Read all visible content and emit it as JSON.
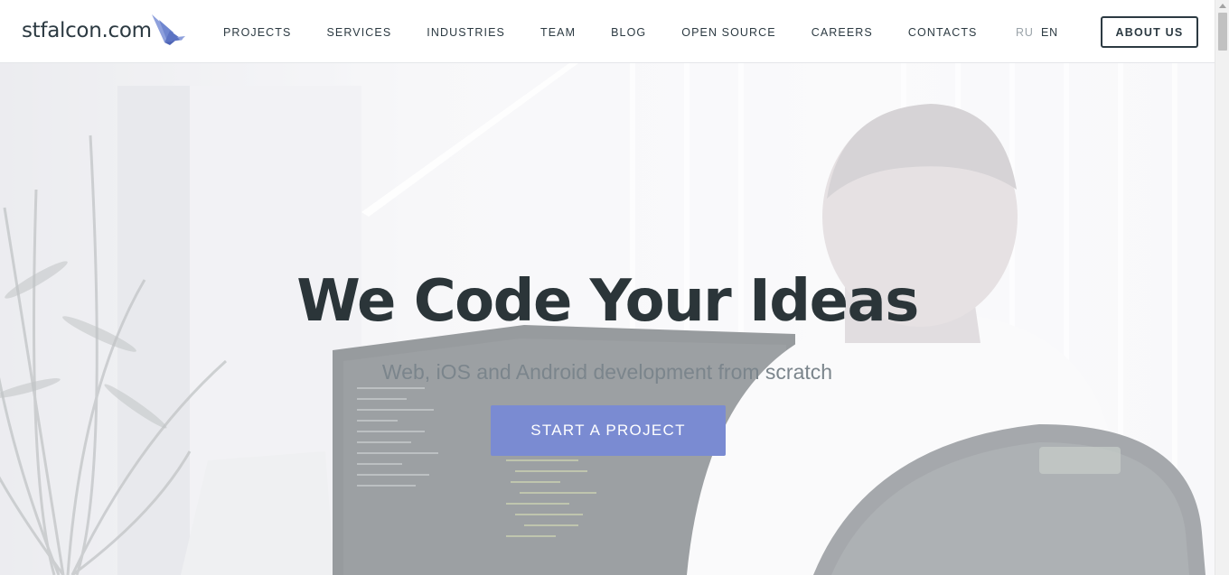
{
  "header": {
    "logo_text": "stfalcon.com",
    "nav": [
      {
        "label": "PROJECTS"
      },
      {
        "label": "SERVICES"
      },
      {
        "label": "INDUSTRIES"
      },
      {
        "label": "TEAM"
      },
      {
        "label": "BLOG"
      },
      {
        "label": "OPEN SOURCE"
      },
      {
        "label": "CAREERS"
      },
      {
        "label": "CONTACTS"
      }
    ],
    "lang_ru": "RU",
    "lang_en": "EN",
    "about_label": "ABOUT US"
  },
  "hero": {
    "title": "We Code Your Ideas",
    "subtitle": "Web, iOS and Android development from scratch",
    "cta_label": "START A PROJECT"
  },
  "colors": {
    "accent": "#7a8bd2",
    "text_dark": "#2c3a42",
    "logo_bird": "#6f86cf"
  },
  "icons": {
    "logo": "falcon-bird-icon"
  }
}
